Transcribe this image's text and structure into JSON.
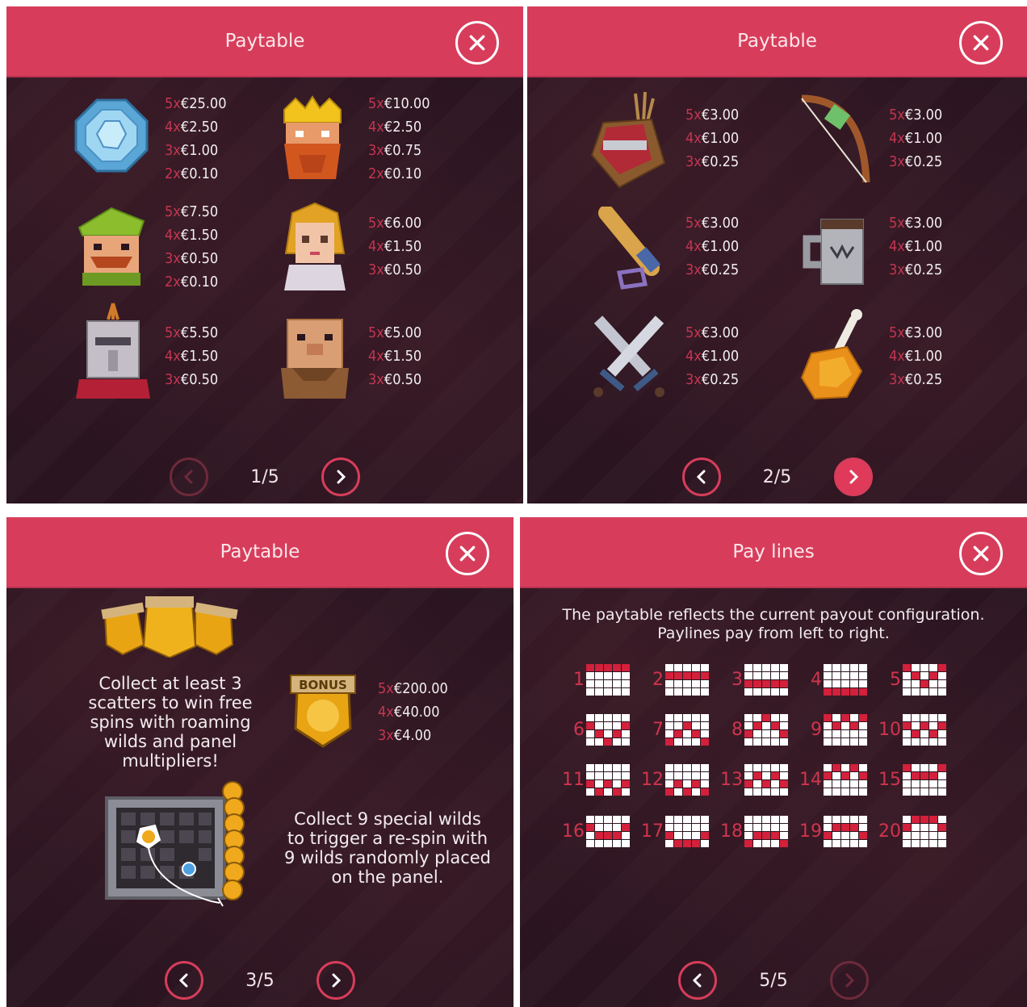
{
  "colors": {
    "header": "#d73d5b",
    "accent": "#e03a5a",
    "multiplier": "#c43552",
    "panel_bg": "#2b1521"
  },
  "panels": [
    {
      "title": "Paytable",
      "page": "1/5",
      "symbols": [
        {
          "icon": "blue-wild-gem-icon",
          "pays": [
            [
              "5x",
              "€25.00"
            ],
            [
              "4x",
              "€2.50"
            ],
            [
              "3x",
              "€1.00"
            ],
            [
              "2x",
              "€0.10"
            ]
          ]
        },
        {
          "icon": "king-icon",
          "pays": [
            [
              "5x",
              "€10.00"
            ],
            [
              "4x",
              "€2.50"
            ],
            [
              "3x",
              "€0.75"
            ],
            [
              "2x",
              "€0.10"
            ]
          ]
        },
        {
          "icon": "robin-hood-icon",
          "pays": [
            [
              "5x",
              "€7.50"
            ],
            [
              "4x",
              "€1.50"
            ],
            [
              "3x",
              "€0.50"
            ],
            [
              "2x",
              "€0.10"
            ]
          ]
        },
        {
          "icon": "maiden-icon",
          "pays": [
            [
              "5x",
              "€6.00"
            ],
            [
              "4x",
              "€1.50"
            ],
            [
              "3x",
              "€0.50"
            ]
          ]
        },
        {
          "icon": "knight-helmet-icon",
          "pays": [
            [
              "5x",
              "€5.50"
            ],
            [
              "4x",
              "€1.50"
            ],
            [
              "3x",
              "€0.50"
            ]
          ]
        },
        {
          "icon": "friar-icon",
          "pays": [
            [
              "5x",
              "€5.00"
            ],
            [
              "4x",
              "€1.50"
            ],
            [
              "3x",
              "€0.50"
            ]
          ]
        }
      ]
    },
    {
      "title": "Paytable",
      "page": "2/5",
      "symbols": [
        {
          "icon": "quiver-icon",
          "pays": [
            [
              "5x",
              "€3.00"
            ],
            [
              "4x",
              "€1.00"
            ],
            [
              "3x",
              "€0.25"
            ]
          ]
        },
        {
          "icon": "bow-icon",
          "pays": [
            [
              "5x",
              "€3.00"
            ],
            [
              "4x",
              "€1.00"
            ],
            [
              "3x",
              "€0.25"
            ]
          ]
        },
        {
          "icon": "club-icon",
          "pays": [
            [
              "5x",
              "€3.00"
            ],
            [
              "4x",
              "€1.00"
            ],
            [
              "3x",
              "€0.25"
            ]
          ]
        },
        {
          "icon": "tankard-icon",
          "pays": [
            [
              "5x",
              "€3.00"
            ],
            [
              "4x",
              "€1.00"
            ],
            [
              "3x",
              "€0.25"
            ]
          ]
        },
        {
          "icon": "crossed-swords-icon",
          "pays": [
            [
              "5x",
              "€3.00"
            ],
            [
              "4x",
              "€1.00"
            ],
            [
              "3x",
              "€0.25"
            ]
          ]
        },
        {
          "icon": "chicken-leg-icon",
          "pays": [
            [
              "5x",
              "€3.00"
            ],
            [
              "4x",
              "€1.00"
            ],
            [
              "3x",
              "€0.25"
            ]
          ]
        }
      ]
    },
    {
      "title": "Paytable",
      "page": "3/5",
      "scatter_text": [
        "Collect at least 3",
        "scatters to win free",
        "spins with roaming",
        "wilds and panel",
        "multipliers!"
      ],
      "bonus_word": "BONUS",
      "bonus_pays": [
        [
          "5x",
          "€200.00"
        ],
        [
          "4x",
          "€40.00"
        ],
        [
          "3x",
          "€4.00"
        ]
      ],
      "wild_text": [
        "Collect 9 special wilds",
        "to trigger a re-spin with",
        "9 wilds randomly placed",
        "on the panel."
      ]
    },
    {
      "title": "Pay lines",
      "page": "5/5",
      "intro": [
        "The paytable reflects the current payout configuration.",
        "Paylines pay from left to right."
      ],
      "lines": [
        {
          "n": "1",
          "rows": [
            0,
            0,
            0,
            0,
            0
          ]
        },
        {
          "n": "2",
          "rows": [
            1,
            1,
            1,
            1,
            1
          ]
        },
        {
          "n": "3",
          "rows": [
            2,
            2,
            2,
            2,
            2
          ]
        },
        {
          "n": "4",
          "rows": [
            3,
            3,
            3,
            3,
            3
          ]
        },
        {
          "n": "5",
          "rows": [
            0,
            1,
            2,
            1,
            0
          ]
        },
        {
          "n": "6",
          "rows": [
            1,
            2,
            3,
            2,
            1
          ]
        },
        {
          "n": "7",
          "rows": [
            3,
            2,
            1,
            2,
            3
          ]
        },
        {
          "n": "8",
          "rows": [
            2,
            1,
            0,
            1,
            2
          ]
        },
        {
          "n": "9",
          "rows": [
            0,
            1,
            0,
            1,
            0
          ]
        },
        {
          "n": "10",
          "rows": [
            1,
            2,
            1,
            2,
            1
          ]
        },
        {
          "n": "11",
          "rows": [
            2,
            3,
            2,
            3,
            2
          ]
        },
        {
          "n": "12",
          "rows": [
            3,
            2,
            3,
            2,
            3
          ]
        },
        {
          "n": "13",
          "rows": [
            2,
            1,
            2,
            1,
            2
          ]
        },
        {
          "n": "14",
          "rows": [
            1,
            0,
            1,
            0,
            1
          ]
        },
        {
          "n": "15",
          "rows": [
            0,
            1,
            1,
            1,
            0
          ]
        },
        {
          "n": "16",
          "rows": [
            1,
            2,
            2,
            2,
            1
          ]
        },
        {
          "n": "17",
          "rows": [
            2,
            3,
            3,
            3,
            2
          ]
        },
        {
          "n": "18",
          "rows": [
            3,
            2,
            2,
            2,
            3
          ]
        },
        {
          "n": "19",
          "rows": [
            2,
            1,
            1,
            1,
            2
          ]
        },
        {
          "n": "20",
          "rows": [
            1,
            0,
            0,
            0,
            1
          ]
        }
      ]
    }
  ]
}
